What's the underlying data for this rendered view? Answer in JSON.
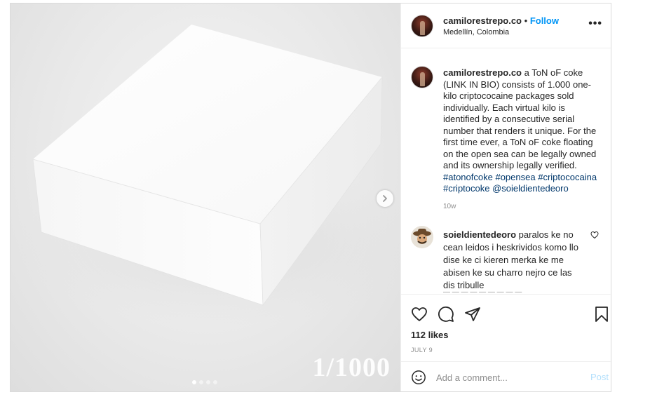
{
  "media": {
    "counter_text": "1/1000",
    "next_button": "chevron-right-icon",
    "dots": 4,
    "active_dot": 0
  },
  "header": {
    "username": "camilorestrepo.co",
    "separator": "•",
    "follow_label": "Follow",
    "location": "Medellín, Colombia",
    "more_label": "•••"
  },
  "caption": {
    "username": "camilorestrepo.co",
    "text": "a ToN oF coke (LINK IN BIO) consists of 1.000 one-kilo criptococaine packages sold individually. Each virtual kilo is identified by a consecutive serial number that renders it unique. For the first time ever, a ToN oF coke floating on the open sea can be legally owned and its ownership legally verified.",
    "hashtags": [
      "#atonofcoke",
      "#opensea",
      "#criptococaina",
      "#criptocoke"
    ],
    "mention": "@soieldientedeoro",
    "time": "10w"
  },
  "comment": {
    "username": "soieldientedeoro",
    "text": "paralos ke no cean leidos i heskrividos komo llo dise ke ci kieren merka ke me abisen ke su charro nejro ce las dis tribulle"
  },
  "actions": {
    "likes": "112 likes",
    "date": "JULY 9",
    "icons": [
      "heart-icon",
      "comment-icon",
      "share-icon",
      "bookmark-icon"
    ]
  },
  "add_comment": {
    "placeholder": "Add a comment...",
    "post_label": "Post"
  },
  "colors": {
    "link": "#0095f6",
    "hashtag": "#00376b",
    "muted": "#8e8e8e",
    "post_disabled": "#b2dffc"
  }
}
